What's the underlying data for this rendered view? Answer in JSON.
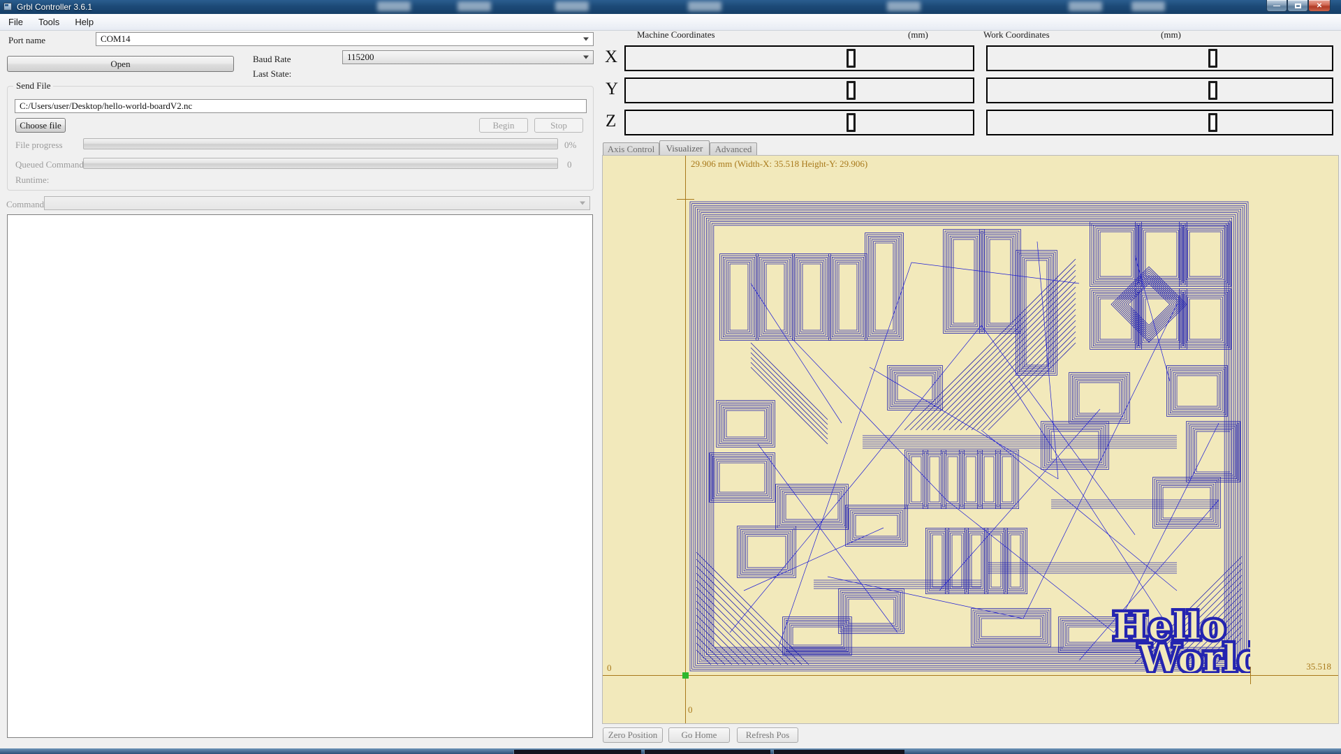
{
  "window": {
    "title": "Grbl Controller 3.6.1",
    "minimize_glyph": "—",
    "close_glyph": "✕"
  },
  "menu": {
    "items": [
      "File",
      "Tools",
      "Help"
    ]
  },
  "connection": {
    "port_label": "Port name",
    "port_value": "COM14",
    "open_button": "Open",
    "baud_label": "Baud Rate",
    "baud_value": "115200",
    "last_state_label": "Last State:"
  },
  "send_file": {
    "group_label": "Send File",
    "file_path": "C:/Users/user/Desktop/hello-world-boardV2.nc",
    "choose_file_button": "Choose file",
    "begin_button": "Begin",
    "stop_button": "Stop",
    "file_progress_label": "File progress",
    "file_progress_value": "0%",
    "queued_label": "Queued Commands",
    "queued_value": "0",
    "runtime_label": "Runtime:"
  },
  "command": {
    "label": "Command",
    "value": ""
  },
  "console": {
    "text": ""
  },
  "coords": {
    "machine_label": "Machine Coordinates",
    "machine_units": "(mm)",
    "work_label": "Work Coordinates",
    "work_units": "(mm)",
    "rows": [
      {
        "axis": "X",
        "machine": "0",
        "work": "0"
      },
      {
        "axis": "Y",
        "machine": "0",
        "work": "0"
      },
      {
        "axis": "Z",
        "machine": "0",
        "work": "0"
      }
    ]
  },
  "tabs": {
    "items": [
      {
        "label": "Axis Control"
      },
      {
        "label": "Visualizer"
      },
      {
        "label": "Advanced"
      }
    ],
    "active": "Visualizer"
  },
  "visualizer": {
    "scale_text": "29.906 mm  (Width-X: 35.518  Height-Y: 29.906)",
    "x_min_label": "0",
    "x_max_label": "35.518",
    "y_origin_label": "0",
    "text_hello": "Hello",
    "text_world": "World",
    "colors": {
      "board_bg": "#f2e9bb",
      "trace": "#2424b0",
      "rapid": "#1b1bd6",
      "axis": "#a8791b",
      "origin_dot": "#2eb82e"
    }
  },
  "viz_buttons": {
    "items": [
      "Zero Position",
      "Go Home",
      "Refresh Pos"
    ]
  }
}
